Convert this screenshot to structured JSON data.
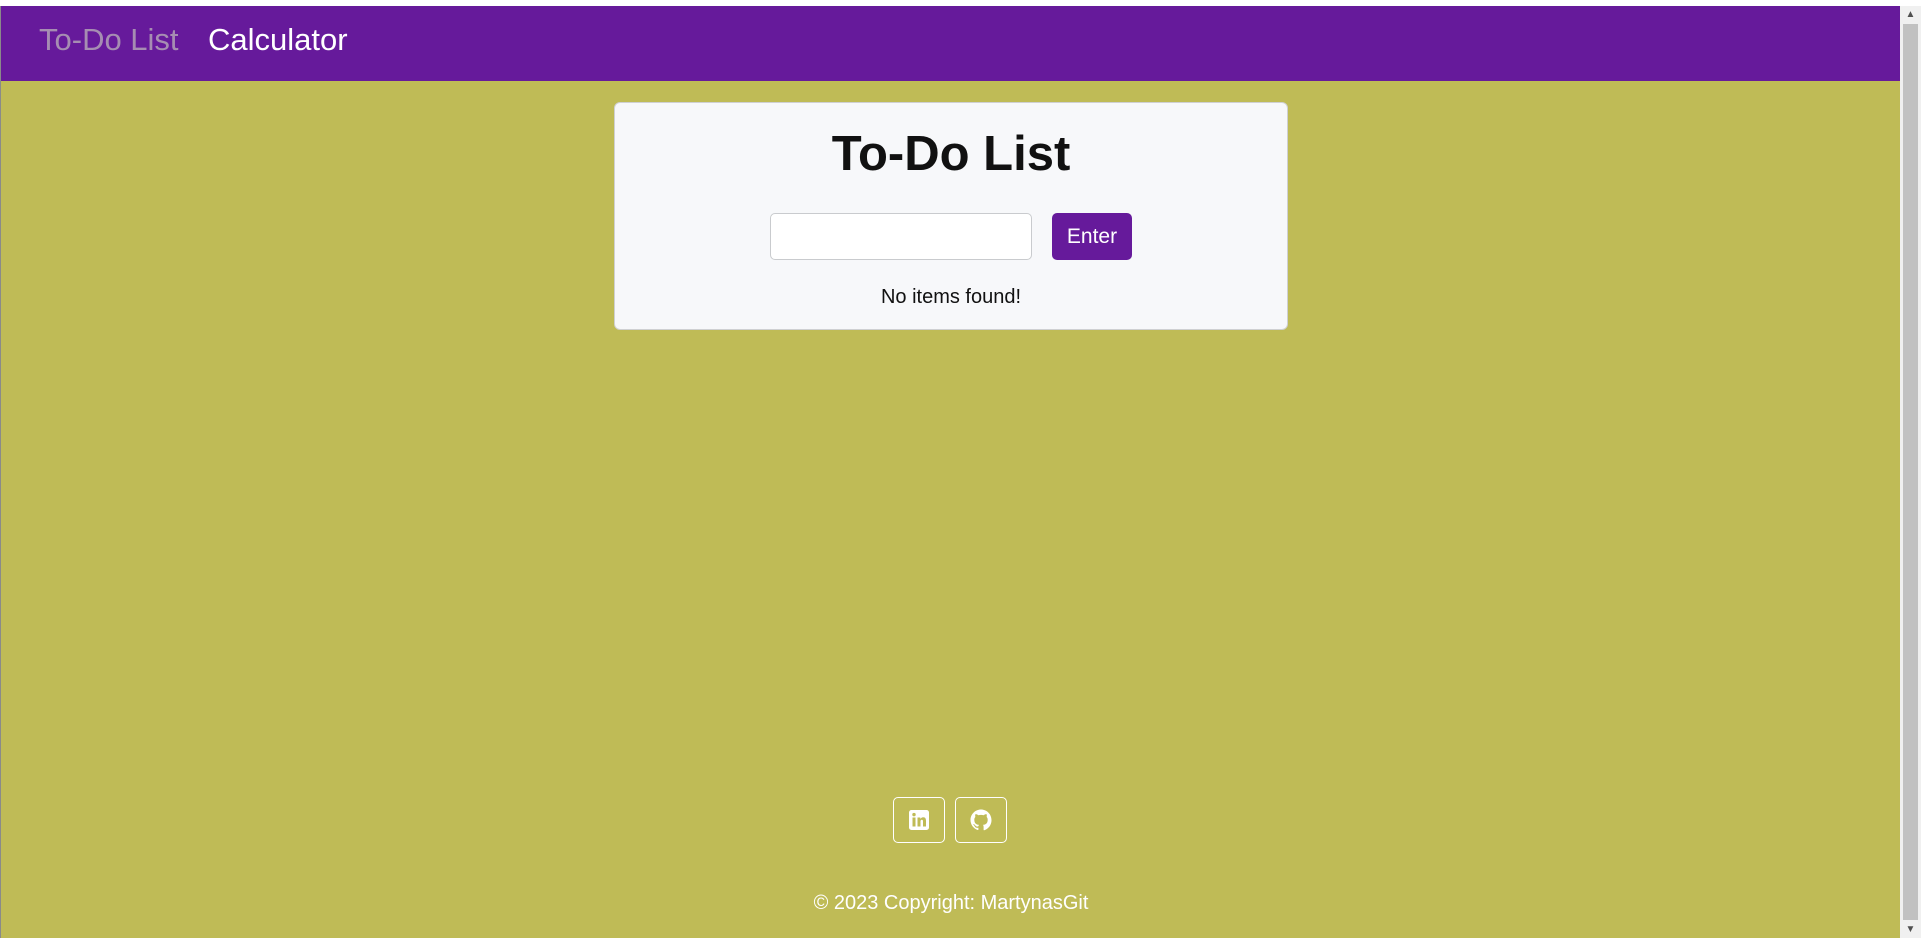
{
  "navbar": {
    "links": [
      {
        "label": "To-Do List",
        "active": true
      },
      {
        "label": "Calculator",
        "active": false
      }
    ]
  },
  "todo": {
    "title": "To-Do List",
    "input_value": "",
    "input_placeholder": "",
    "enter_label": "Enter",
    "empty_message": "No items found!"
  },
  "footer": {
    "social": [
      {
        "icon": "linkedin-icon"
      },
      {
        "icon": "github-icon"
      }
    ],
    "copyright": "© 2023 Copyright: MartynasGit"
  },
  "colors": {
    "navbar": "#661a9b",
    "background": "#bfbb56",
    "card": "#f7f8fa",
    "button": "#661a9b",
    "nav_active": "#a68db2"
  },
  "scrollbar": {
    "up_arrow": "▲",
    "down_arrow": "▼"
  }
}
